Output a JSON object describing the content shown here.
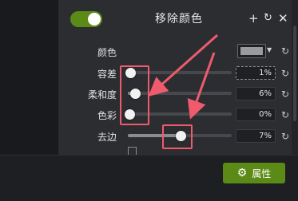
{
  "panel": {
    "title": "移除颜色",
    "enabled": true,
    "accent": "#5c8a16",
    "header_icons": [
      "plus-icon",
      "reset-icon",
      "close-icon"
    ]
  },
  "rows": {
    "color": {
      "label": "颜色",
      "swatch_color": "#9b9a9e"
    },
    "tolerance": {
      "label": "容差",
      "value": "1%",
      "level": 0.01
    },
    "softness": {
      "label": "柔和度",
      "value": "6%",
      "level": 0.06
    },
    "hue": {
      "label": "色彩",
      "value": "0%",
      "level": 0.0
    },
    "defringe": {
      "label": "去边",
      "value": "7%",
      "level": 0.07
    }
  },
  "footer": {
    "properties_label": "属性"
  },
  "annotation_color": "#ef5a6d"
}
